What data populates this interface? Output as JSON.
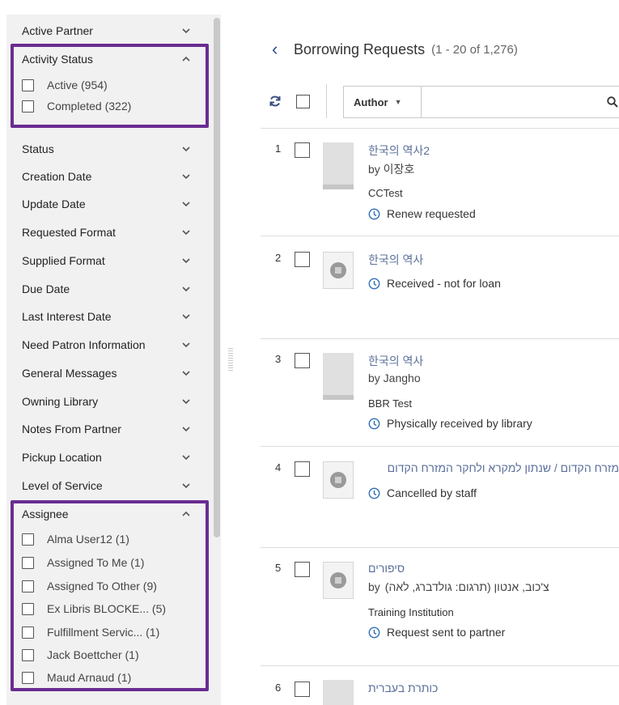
{
  "facets": {
    "active_partner": "Active Partner",
    "activity_status": {
      "label": "Activity Status",
      "options": [
        {
          "label": "Active (954)"
        },
        {
          "label": "Completed (322)"
        }
      ]
    },
    "list": [
      "Status",
      "Creation Date",
      "Update Date",
      "Requested Format",
      "Supplied Format",
      "Due Date",
      "Last Interest Date",
      "Need Patron Information",
      "General Messages",
      "Owning Library",
      "Notes From Partner",
      "Pickup Location",
      "Level of Service"
    ],
    "assignee": {
      "label": "Assignee",
      "options": [
        {
          "label": "Alma User12  (1)"
        },
        {
          "label": "Assigned To Me  (1)"
        },
        {
          "label": "Assigned To Other  (9)"
        },
        {
          "label": "Ex Libris BLOCKE...  (5)"
        },
        {
          "label": "Fulfillment Servic...  (1)"
        },
        {
          "label": "Jack Boettcher  (1)"
        },
        {
          "label": "Maud Arnaud  (1)"
        }
      ]
    }
  },
  "header": {
    "title": "Borrowing Requests",
    "count": "(1 - 20 of 1,276)"
  },
  "toolbar": {
    "search_field": "Author",
    "search_value": ""
  },
  "colors": {
    "highlight": "#6a2c91",
    "title_link": "#5a6f9a",
    "status_icon": "#2f6fb3"
  },
  "items": [
    {
      "num": "1",
      "title": "한국의 역사2",
      "by": "by 이장호",
      "institution": "CCTest",
      "status": "Renew requested"
    },
    {
      "num": "2",
      "title": "한국의 역사",
      "status": "Received - not for loan"
    },
    {
      "num": "3",
      "title": "한국의 역사",
      "by": "by Jangho",
      "institution": "BBR Test",
      "status": "Physically received by library"
    },
    {
      "num": "4",
      "title": "מזרח הקדום / שנתון למקרא ולחקר המזרח הקדום",
      "status": "Cancelled by staff"
    },
    {
      "num": "5",
      "title": "סיפורים",
      "by": "צ'כוב, אנטון (תרגום: גולדברג, לאה)",
      "by_prefix": "by",
      "institution": "Training Institution",
      "status": "Request sent to partner"
    },
    {
      "num": "6",
      "title": "כותרת בעברית"
    }
  ]
}
